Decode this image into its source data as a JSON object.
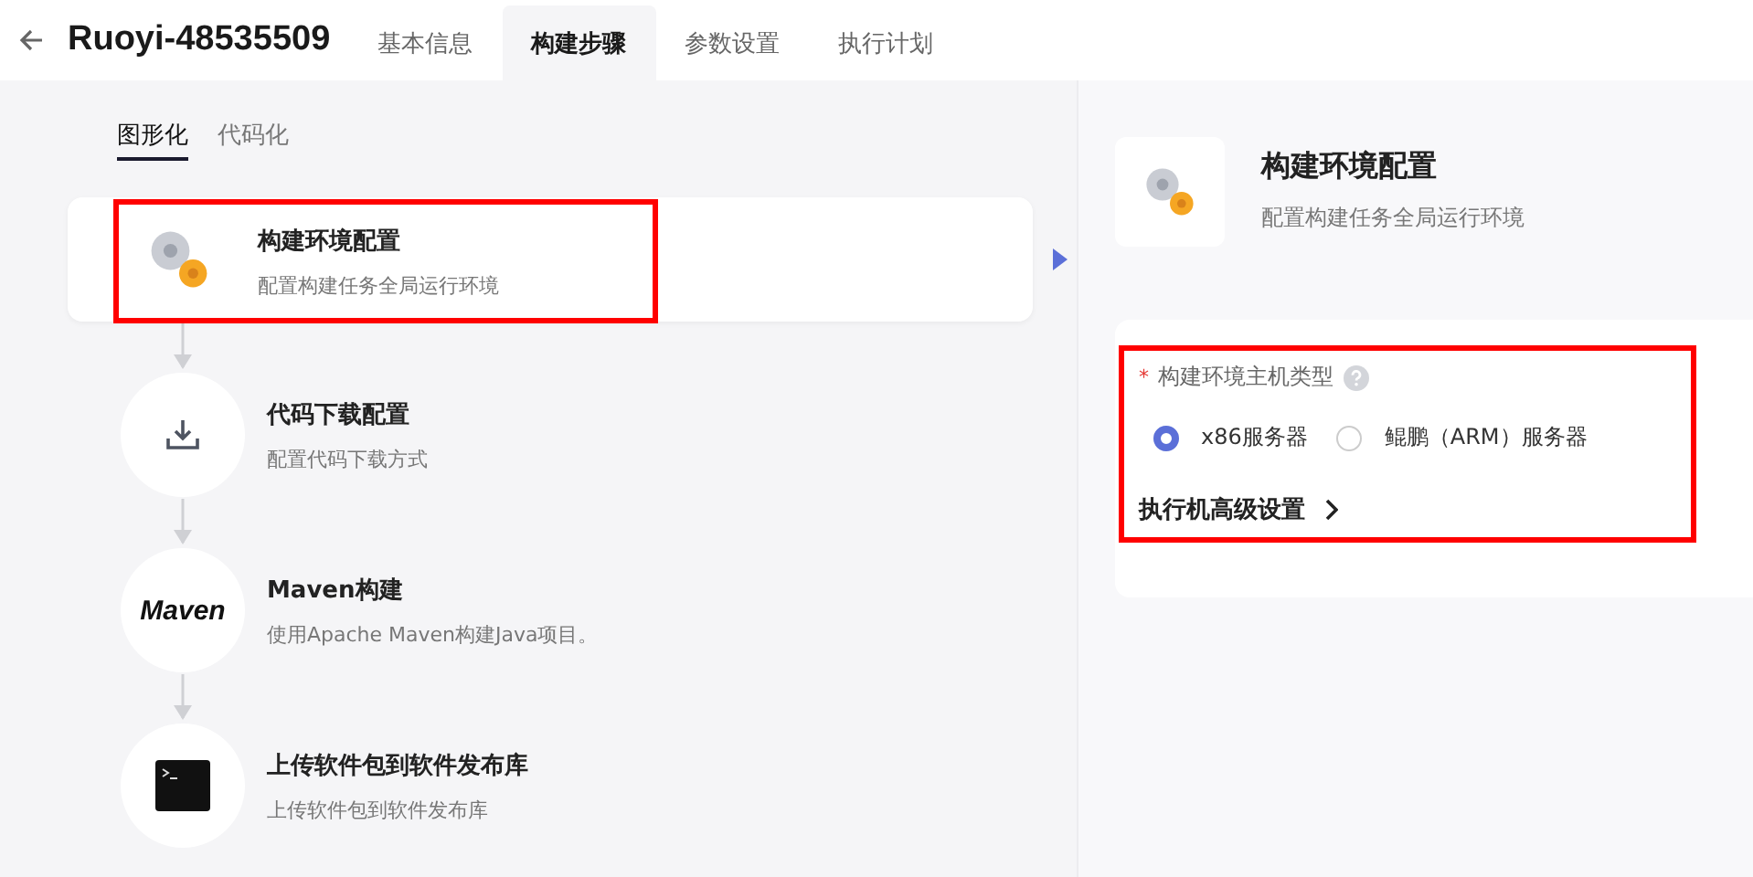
{
  "header": {
    "title": "Ruoyi-48535509",
    "tabs": [
      {
        "label": "基本信息",
        "selected": false
      },
      {
        "label": "构建步骤",
        "selected": true
      },
      {
        "label": "参数设置",
        "selected": false
      },
      {
        "label": "执行计划",
        "selected": false
      }
    ]
  },
  "view_tabs": [
    {
      "label": "图形化",
      "selected": true
    },
    {
      "label": "代码化",
      "selected": false
    }
  ],
  "steps": [
    {
      "kind": "gears",
      "title": "构建环境配置",
      "description": "配置构建任务全局运行环境",
      "selected": true,
      "highlighted": true
    },
    {
      "kind": "download",
      "title": "代码下载配置",
      "description": "配置代码下载方式",
      "selected": false,
      "highlighted": false
    },
    {
      "kind": "maven",
      "logo_text": "Maven",
      "title": "Maven构建",
      "description": "使用Apache Maven构建Java项目。",
      "selected": false,
      "highlighted": false
    },
    {
      "kind": "terminal",
      "title": "上传软件包到软件发布库",
      "description": "上传软件包到软件发布库",
      "selected": false,
      "highlighted": false
    }
  ],
  "detail": {
    "kind": "gears",
    "title": "构建环境配置",
    "description": "配置构建任务全局运行环境",
    "form": {
      "highlighted": true,
      "label": "构建环境主机类型",
      "required_mark": "*",
      "options": [
        {
          "label": "x86服务器",
          "selected": true
        },
        {
          "label": "鲲鹏（ARM）服务器",
          "selected": false
        }
      ],
      "advanced_link": "执行机高级设置"
    }
  }
}
